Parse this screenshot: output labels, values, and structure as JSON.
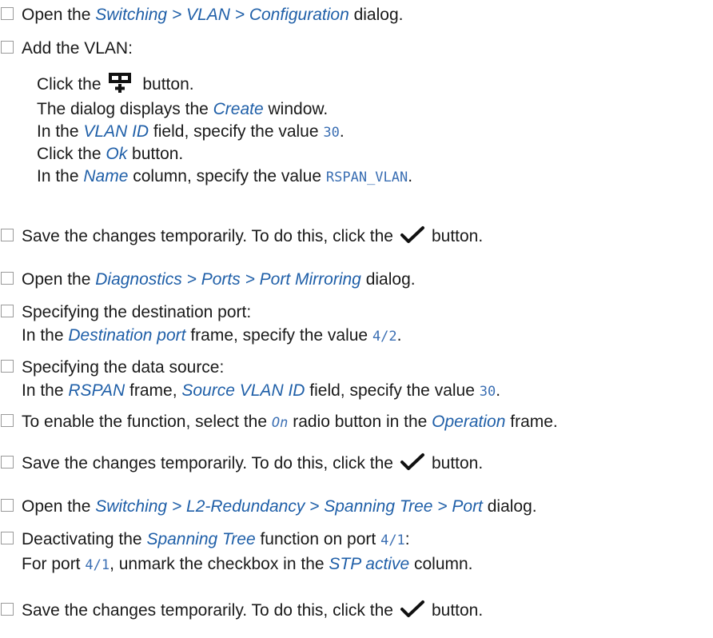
{
  "steps": [
    {
      "t1": "Open the ",
      "r1": "Switching > VLAN > Configuration",
      "t2": " dialog."
    },
    {
      "t1": "Add the VLAN:"
    },
    {
      "t1": "Save the changes temporarily. To do this, click the",
      "t2": "button."
    },
    {
      "t1": "Open the ",
      "r1": "Diagnostics > Ports > Port Mirroring",
      "t2": " dialog."
    },
    {
      "t1": "Specifying the destination port:"
    },
    {
      "t1": "Specifying the data source:"
    },
    {
      "t1": "To enable the function, select the ",
      "v1": "On",
      "t2": " radio button in the ",
      "r1": "Operation",
      "t3": " frame."
    },
    {
      "t1": "Save the changes temporarily. To do this, click the",
      "t2": "button."
    },
    {
      "t1": "Open the ",
      "r1": "Switching > L2-Redundancy > Spanning Tree > Port",
      "t2": " dialog."
    },
    {
      "t1": "Deactivating the ",
      "r1": "Spanning Tree",
      "t2": " function on port ",
      "v1": "4/1",
      "t3": ":"
    },
    {
      "t1": "Save the changes temporarily. To do this, click the",
      "t2": "button."
    }
  ],
  "vlan": {
    "l1a": "Click the",
    "l1b": " button.",
    "l2a": "The dialog displays the ",
    "l2r": "Create",
    "l2b": " window.",
    "l3a": "In the ",
    "l3r": "VLAN ID",
    "l3b": " field, specify the value ",
    "l3v": "30",
    "l3c": ".",
    "l4a": "Click the ",
    "l4r": "Ok",
    "l4b": " button.",
    "l5a": "In the ",
    "l5r": "Name",
    "l5b": " column, specify the value ",
    "l5v": "RSPAN_VLAN",
    "l5c": "."
  },
  "dest": {
    "a": "In the ",
    "r": "Destination port",
    "b": " frame, specify the value ",
    "v": "4/2",
    "c": "."
  },
  "src": {
    "a": "In the ",
    "r1": "RSPAN",
    "b": " frame, ",
    "r2": "Source VLAN ID",
    "c": " field, specify the value ",
    "v": "30",
    "d": "."
  },
  "stp": {
    "a": "For port ",
    "v": "4/1",
    "b": ", unmark the checkbox in the ",
    "r": "STP active",
    "c": " column."
  },
  "icons": {
    "add": "add-row-icon",
    "save": "checkmark-icon"
  },
  "colors": {
    "reference": "#1f5fa8",
    "value": "#3b6fb3",
    "checkbox": "#9a9a9a"
  }
}
